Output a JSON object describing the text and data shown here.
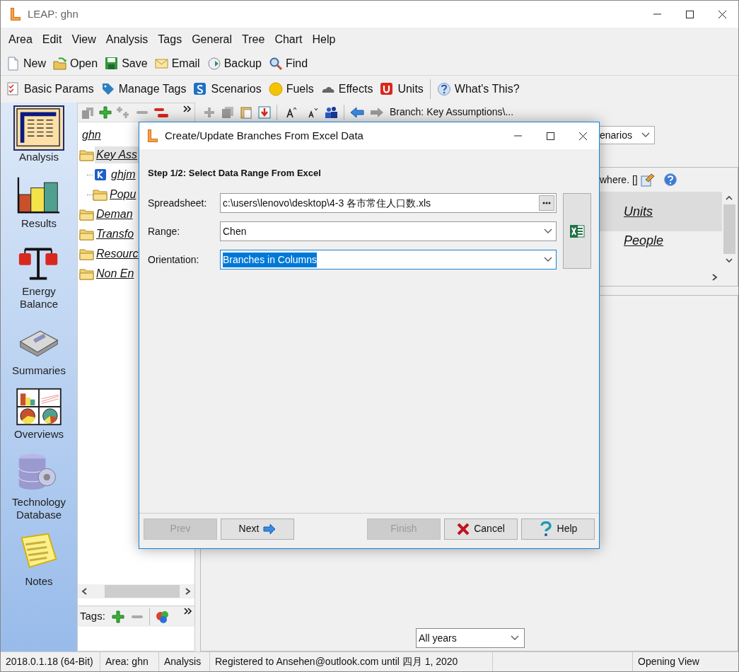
{
  "window": {
    "title": "LEAP: ghn"
  },
  "menu": [
    "Area",
    "Edit",
    "View",
    "Analysis",
    "Tags",
    "General",
    "Tree",
    "Chart",
    "Help"
  ],
  "toolbar_main": [
    {
      "label": "New"
    },
    {
      "label": "Open"
    },
    {
      "label": "Save"
    },
    {
      "label": "Email"
    },
    {
      "label": "Backup"
    },
    {
      "label": "Find"
    }
  ],
  "toolbar_params": [
    {
      "label": "Basic Params"
    },
    {
      "label": "Manage Tags"
    },
    {
      "label": "Scenarios"
    },
    {
      "label": "Fuels"
    },
    {
      "label": "Effects"
    },
    {
      "label": "Units"
    },
    {
      "label": "What's This?"
    }
  ],
  "views": [
    {
      "label": "Analysis",
      "selected": true
    },
    {
      "label": "Results",
      "selected": false
    },
    {
      "label": "Energy Balance",
      "selected": false
    },
    {
      "label": "Summaries",
      "selected": false
    },
    {
      "label": "Overviews",
      "selected": false
    },
    {
      "label": "Technology Database",
      "selected": false
    },
    {
      "label": "Notes",
      "selected": false
    }
  ],
  "tree": [
    {
      "label": "ghn",
      "kind": "area",
      "selected": false,
      "children": [
        {
          "label": "Key Ass",
          "kind": "folder",
          "selected": true,
          "children": [
            {
              "label": "ghjm",
              "kind": "variable",
              "selected": false
            },
            {
              "label": "Popu",
              "kind": "folder",
              "selected": false
            }
          ]
        },
        {
          "label": "Deman",
          "kind": "folder",
          "selected": false
        },
        {
          "label": "Transfo",
          "kind": "folder",
          "selected": false
        },
        {
          "label": "Resourc",
          "kind": "folder",
          "selected": false
        },
        {
          "label": "Non En",
          "kind": "folder",
          "selected": false
        }
      ]
    }
  ],
  "tags_bar": {
    "label": "Tags:"
  },
  "branch_path": "Branch: Key Assumptions\\...",
  "scenario_dropdown": {
    "value": "enarios"
  },
  "info_text": "where. []",
  "grid_rows": [
    {
      "label": "Units",
      "selected": true
    },
    {
      "label": "People",
      "selected": false
    }
  ],
  "years_dropdown": {
    "value": "All years"
  },
  "status_bar": {
    "segments": [
      "2018.0.1.18 (64-Bit)",
      "Area: ghn",
      "Analysis",
      "Registered to Ansehen@outlook.com until 四月 1, 2020"
    ],
    "right": "Opening View"
  },
  "dialog": {
    "title": "Create/Update Branches From Excel Data",
    "step": "Step 1/2: Select Data Range From Excel",
    "fields": [
      {
        "label": "Spreadsheet:",
        "value": "c:\\users\\lenovo\\desktop\\4-3 各市常住人口数.xls",
        "kind": "browse",
        "focused": false,
        "text_selected": false
      },
      {
        "label": "Range:",
        "value": "Chen",
        "kind": "dropdown",
        "focused": false,
        "text_selected": false
      },
      {
        "label": "Orientation:",
        "value": "Branches in Columns",
        "kind": "dropdown",
        "focused": true,
        "text_selected": true
      }
    ],
    "buttons": [
      {
        "label": "Prev",
        "disabled": true
      },
      {
        "label": "Next",
        "disabled": false
      },
      {
        "label": "Finish",
        "disabled": true
      },
      {
        "label": "Cancel",
        "disabled": false
      },
      {
        "label": "Help",
        "disabled": false
      }
    ]
  }
}
